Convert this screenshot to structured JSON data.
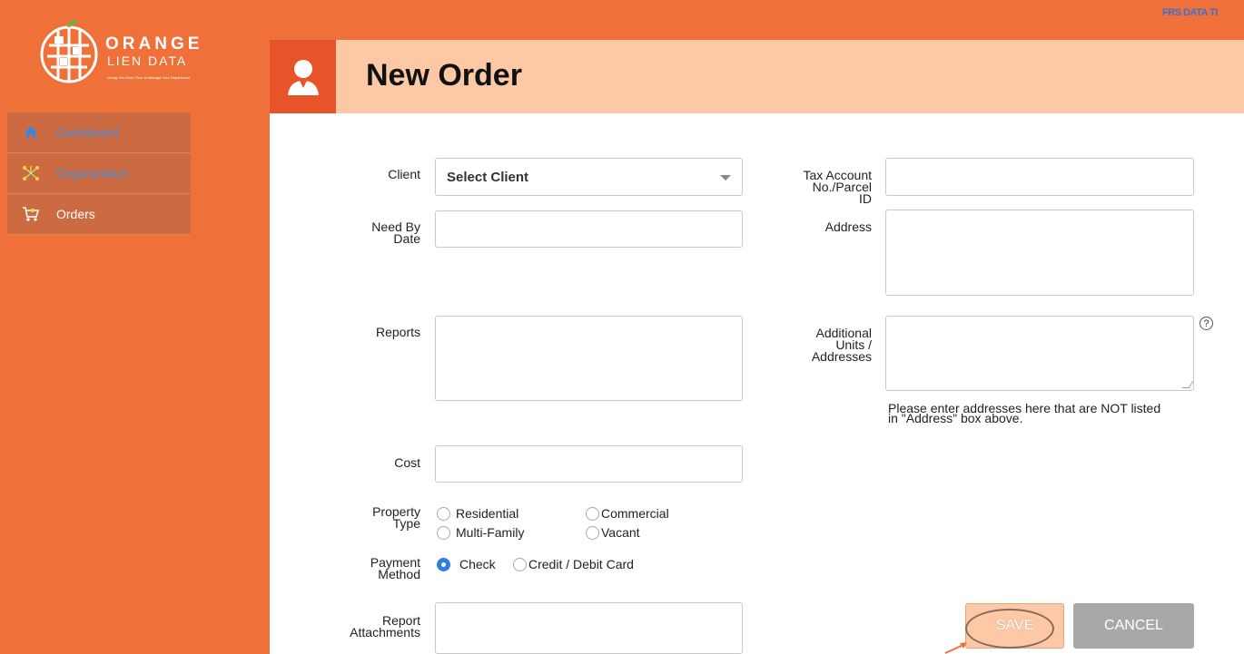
{
  "topbar": {
    "right_text": "FRS DATA TI"
  },
  "logo": {
    "word1": "ORANGE",
    "word2": "LIEN DATA",
    "tagline": "Giving You More Time to Manage Your Department"
  },
  "sidebar": {
    "items": [
      {
        "label": "Dashboard",
        "icon": "home-icon"
      },
      {
        "label": "Organization",
        "icon": "network-icon"
      },
      {
        "label": "Orders",
        "icon": "cart-icon"
      }
    ]
  },
  "header": {
    "title": "New Order",
    "icon": "user-icon"
  },
  "form": {
    "client": {
      "label": "Client",
      "value": "Select Client"
    },
    "need_by": {
      "label_line1": "Need By",
      "label_line2": "Date",
      "value": ""
    },
    "reports": {
      "label": "Reports",
      "value": ""
    },
    "cost": {
      "label": "Cost",
      "value": ""
    },
    "property_type": {
      "label_line1": "Property",
      "label_line2": "Type",
      "options": [
        "Residential",
        "Commercial",
        "Multi-Family",
        "Vacant"
      ]
    },
    "payment_method": {
      "label_line1": "Payment",
      "label_line2": "Method",
      "options": [
        "Check",
        "Credit / Debit Card"
      ],
      "selected": "Check"
    },
    "attachments": {
      "label_line1": "Report",
      "label_line2": "Attachments"
    },
    "tax_account": {
      "label_line1": "Tax Account",
      "label_line2": "No./Parcel",
      "label_line3": "ID",
      "value": ""
    },
    "address": {
      "label": "Address",
      "value": ""
    },
    "additional": {
      "label_line1": "Additional",
      "label_line2": "Units /",
      "label_line3": "Addresses",
      "help": "?",
      "note_line1": "Please enter addresses here that are NOT listed",
      "note_line2": "in \"Address\" box above."
    }
  },
  "buttons": {
    "save": "SAVE",
    "cancel": "CANCEL"
  }
}
